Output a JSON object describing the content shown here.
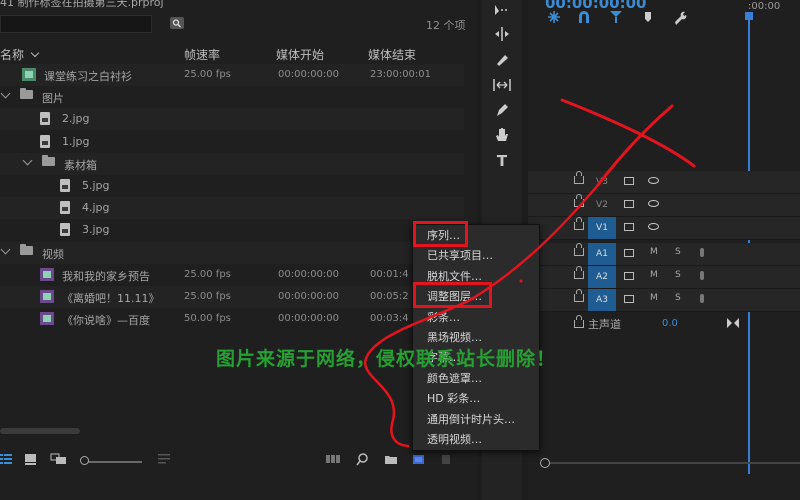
{
  "project": {
    "title": "41 制作标签在拍摄第三天.prproj",
    "item_count": "12 个项",
    "columns": {
      "name": "名称",
      "fps": "帧速率",
      "media_start": "媒体开始",
      "media_end": "媒体结束"
    },
    "items": [
      {
        "kind": "sequence",
        "indent": 1,
        "name": "课堂练习之白衬衫",
        "fps": "25.00 fps",
        "start": "00:00:00:00",
        "end": "23:00:00:01"
      },
      {
        "kind": "folder",
        "indent": 0,
        "name": "图片",
        "fps": "",
        "start": "",
        "end": ""
      },
      {
        "kind": "image",
        "indent": 2,
        "name": "2.jpg",
        "fps": "",
        "start": "",
        "end": ""
      },
      {
        "kind": "image",
        "indent": 2,
        "name": "1.jpg",
        "fps": "",
        "start": "",
        "end": ""
      },
      {
        "kind": "folder",
        "indent": 1,
        "name": "素材箱",
        "fps": "",
        "start": "",
        "end": ""
      },
      {
        "kind": "image",
        "indent": 3,
        "name": "5.jpg",
        "fps": "",
        "start": "",
        "end": ""
      },
      {
        "kind": "image",
        "indent": 3,
        "name": "4.jpg",
        "fps": "",
        "start": "",
        "end": ""
      },
      {
        "kind": "image",
        "indent": 3,
        "name": "3.jpg",
        "fps": "",
        "start": "",
        "end": ""
      },
      {
        "kind": "folder",
        "indent": 0,
        "name": "视频",
        "fps": "",
        "start": "",
        "end": ""
      },
      {
        "kind": "video",
        "indent": 2,
        "name": "我和我的家乡预告",
        "fps": "25.00 fps",
        "start": "00:00:00:00",
        "end": "00:01:4"
      },
      {
        "kind": "video",
        "indent": 2,
        "name": "《离婚吧！11.11》",
        "fps": "25.00 fps",
        "start": "00:00:00:00",
        "end": "00:05:2"
      },
      {
        "kind": "video",
        "indent": 2,
        "name": "《你说啥》—百度",
        "fps": "50.00 fps",
        "start": "00:00:00:00",
        "end": "00:03:4"
      }
    ]
  },
  "context_menu": {
    "items": [
      "序列…",
      "已共享项目…",
      "脱机文件…",
      "调整图层…",
      "彩条…",
      "黑场视频…",
      "字幕…",
      "颜色遮罩…",
      "HD 彩条…",
      "通用倒计时片头…",
      "透明视频…"
    ],
    "highlighted": [
      "序列…",
      "调整图层…"
    ]
  },
  "timeline": {
    "timecode": "00:00:00:00",
    "ruler_time": ":00:00",
    "tracks": [
      {
        "label": "V3",
        "style": "plain",
        "type": "video"
      },
      {
        "label": "V2",
        "style": "plain",
        "type": "video"
      },
      {
        "label": "V1",
        "style": "blue",
        "type": "video"
      },
      {
        "label": "A1",
        "style": "blue",
        "type": "audio"
      },
      {
        "label": "A2",
        "style": "blue",
        "type": "audio"
      },
      {
        "label": "A3",
        "style": "blue",
        "type": "audio"
      }
    ],
    "master_label": "主声道",
    "master_value": "0.0",
    "mute_label": "M",
    "solo_label": "S"
  },
  "watermark": "图片来源于网络，侵权联系站长删除！",
  "colors": {
    "accent_blue": "#3a8ed6",
    "annotation_red": "#e3141e",
    "watermark_green": "#26a032"
  }
}
